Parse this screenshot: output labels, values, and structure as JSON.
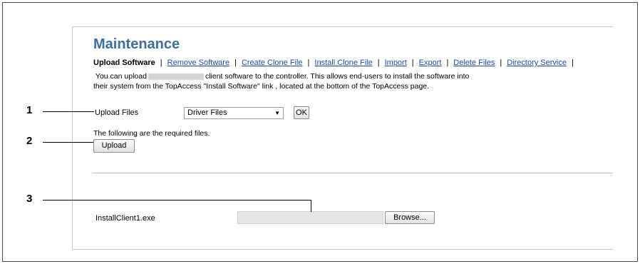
{
  "page": {
    "title": "Maintenance",
    "tabs": [
      {
        "label": "Upload Software",
        "active": true
      },
      {
        "label": "Remove Software",
        "active": false
      },
      {
        "label": "Create Clone File",
        "active": false
      },
      {
        "label": "Install Clone File",
        "active": false
      },
      {
        "label": "Import",
        "active": false
      },
      {
        "label": "Export",
        "active": false
      },
      {
        "label": "Delete Files",
        "active": false
      },
      {
        "label": "Directory Service",
        "active": false
      }
    ],
    "description_part1": "You can upload",
    "description_part2": "client software to the controller. This allows end-users to install the software into",
    "description_line2": "their system from the TopAccess \"Install Software\" link , located at the bottom of the TopAccess page."
  },
  "upload_files": {
    "label": "Upload Files",
    "selected": "Driver Files",
    "ok_label": "OK"
  },
  "required_text": "The following are the required files.",
  "upload_button": "Upload",
  "file_row": {
    "filename": "InstallClient1.exe",
    "browse_label": "Browse..."
  },
  "callouts": [
    "1",
    "2",
    "3"
  ]
}
